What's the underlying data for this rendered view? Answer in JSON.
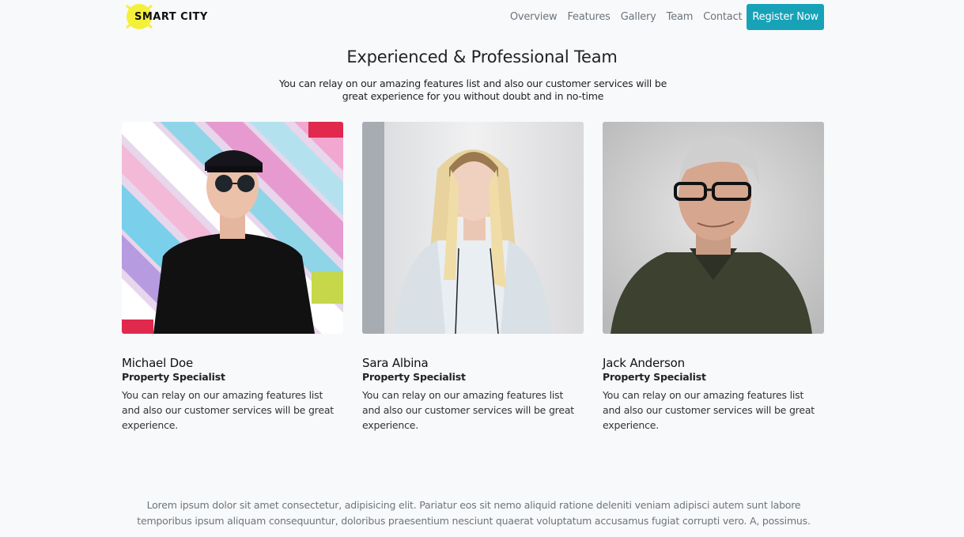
{
  "brand": {
    "name": "SMART CITY",
    "icon": "smart-city-logo"
  },
  "nav": {
    "links": [
      "Overview",
      "Features",
      "Gallery",
      "Team",
      "Contact"
    ],
    "cta": "Register Now"
  },
  "section": {
    "title": "Experienced & Professional Team",
    "subtitle": "You can relay on our amazing features list and also our customer services will be great experience for you without doubt and in no-time"
  },
  "team": [
    {
      "name": "Michael Doe",
      "role": "Property Specialist",
      "bio": "You can relay on our amazing features list and also our customer services will be great experience."
    },
    {
      "name": "Sara Albina",
      "role": "Property Specialist",
      "bio": "You can relay on our amazing features list and also our customer services will be great experience."
    },
    {
      "name": "Jack Anderson",
      "role": "Property Specialist",
      "bio": "You can relay on our amazing features list and also our customer services will be great experience."
    }
  ],
  "footer": {
    "text": "Lorem ipsum dolor sit amet consectetur, adipisicing elit. Pariatur eos sit nemo aliquid ratione deleniti veniam adipisci autem sunt labore temporibus ipsum aliquam consequuntur, doloribus praesentium nesciunt quaerat voluptatum accusamus fugiat corrupti vero. A, possimus."
  },
  "colors": {
    "accent": "#17a2b8",
    "background": "#f8f9fa",
    "muted": "#6c757d"
  }
}
